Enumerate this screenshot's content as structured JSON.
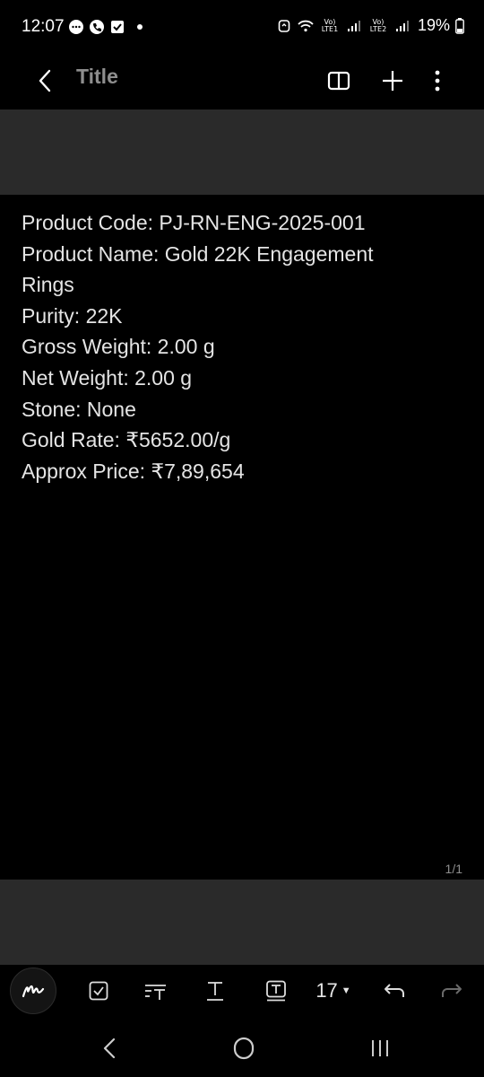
{
  "status_bar": {
    "time": "12:07",
    "network_1": "Vo) LTE1",
    "network_2": "Vo) LTE2",
    "battery_percent": "19%"
  },
  "app_bar": {
    "title": "Title",
    "actions": [
      "book-icon",
      "plus-icon",
      "more-vert-icon"
    ]
  },
  "note": {
    "lines": [
      "Product Code: PJ-RN-ENG-2025-001",
      "Product Name: Gold 22K Engagement",
      "Rings",
      "Purity: 22K",
      "Gross Weight: 2.00 g",
      "Net Weight: 2.00 g",
      "Stone: None",
      "Gold Rate: ₹5652.00/g",
      "Approx Price: ₹7,89,654"
    ],
    "page_indicator": "1/1"
  },
  "toolbar": {
    "font_size": "17",
    "tools": [
      "handwriting-icon",
      "checkbox-icon",
      "text-style-icon",
      "text-format-icon",
      "text-box-icon",
      "undo-icon",
      "redo-icon"
    ]
  },
  "nav_bar": {
    "buttons": [
      "back-icon",
      "home-icon",
      "recents-icon"
    ]
  },
  "colors": {
    "background": "#000000",
    "band": "#2a2a2a",
    "text": "#e4e4e4",
    "title": "#8e8e8e"
  }
}
